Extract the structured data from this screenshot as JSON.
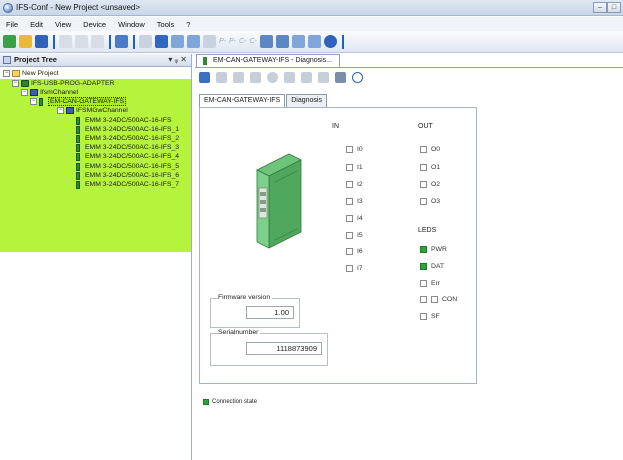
{
  "window": {
    "title": "IFS-Conf - New Project <unsaved>",
    "btn_min": "–",
    "btn_max": "□"
  },
  "menu": [
    "File",
    "Edit",
    "View",
    "Device",
    "Window",
    "Tools",
    "?"
  ],
  "toolbar": {
    "p1": "P-",
    "p2": "P-",
    "c1": "C-",
    "c2": "C-"
  },
  "project_tree": {
    "title": "Project Tree",
    "controls": "▾ ᵩ ✕",
    "items": [
      {
        "label": "New Project",
        "expander": "−"
      },
      {
        "label": "IFS-USB-PROG-ADAPTER",
        "expander": "−"
      },
      {
        "label": "IfsmChannel",
        "expander": "−"
      },
      {
        "label": "EM-CAN-GATEWAY-IFS",
        "expander": "−"
      },
      {
        "label": "IFSMGwChannel",
        "expander": "−"
      },
      {
        "label": "EMM 3-24DC/500AC-16-IFS"
      },
      {
        "label": "EMM 3-24DC/500AC-16-IFS_1"
      },
      {
        "label": "EMM 3-24DC/500AC-16-IFS_2"
      },
      {
        "label": "EMM 3-24DC/500AC-16-IFS_3"
      },
      {
        "label": "EMM 3-24DC/500AC-16-IFS_4"
      },
      {
        "label": "EMM 3-24DC/500AC-16-IFS_5"
      },
      {
        "label": "EMM 3-24DC/500AC-16-IFS_6"
      },
      {
        "label": "EMM 3-24DC/500AC-16-IFS_7"
      }
    ]
  },
  "doc_tab": {
    "label": "EM-CAN-GATEWAY-IFS - Diagnosis..."
  },
  "sub_tabs": {
    "device": "EM-CAN-GATEWAY-IFS",
    "diagnosis": "Diagnosis"
  },
  "inputs": {
    "heading": "IN",
    "items": [
      "I0",
      "I1",
      "I2",
      "I3",
      "I4",
      "I5",
      "I6",
      "I7"
    ]
  },
  "outputs": {
    "heading": "OUT",
    "items": [
      "O0",
      "O1",
      "O2",
      "O3"
    ]
  },
  "leds": {
    "heading": "LEDS",
    "items": [
      {
        "label": "PWR",
        "on": true
      },
      {
        "label": "DAT",
        "on": true
      },
      {
        "label": "Err",
        "on": false
      },
      {
        "label": "CON",
        "on": false
      },
      {
        "label": "SF",
        "on": false
      }
    ]
  },
  "firmware": {
    "label": "Firmware version",
    "value": "1.00"
  },
  "serial": {
    "label": "Serialnumber",
    "value": "1118873909"
  },
  "connection_state": {
    "label": "Connection state",
    "on": true
  },
  "colors": {
    "tree_highlight": "#b6f33c",
    "led_on": "#2aa63a"
  }
}
